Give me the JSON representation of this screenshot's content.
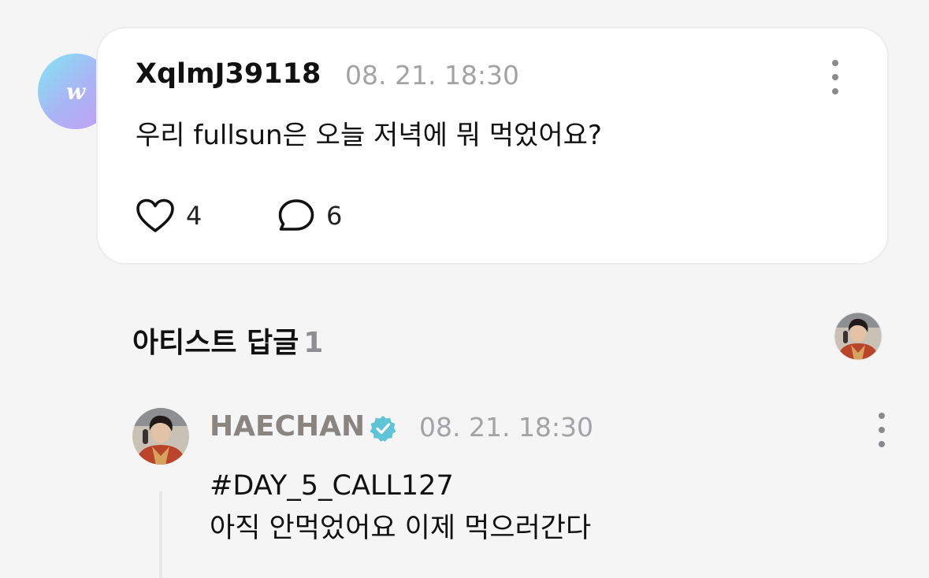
{
  "post": {
    "author": "XqlmJ39118",
    "time": "08. 21. 18:30",
    "avatar_letter": "w",
    "text": "우리 fullsun은 오늘 저녁에 뭐 먹었어요?",
    "likes": "4",
    "comments": "6",
    "icons": {
      "like": "heart-outline-icon",
      "comment": "speech-bubble-icon",
      "more": "more-vertical-icon"
    }
  },
  "artist_replies": {
    "title": "아티스트 답글",
    "count": "1"
  },
  "reply": {
    "author": "HAECHAN",
    "verified_color": "#5fc4d8",
    "time": "08. 21. 18:30",
    "lines": [
      "#DAY_5_CALL127",
      "아직 안먹었어요 이제 먹으러간다"
    ]
  },
  "colors": {
    "background": "#f5f5f6",
    "card": "#ffffff",
    "muted": "#a3a3a6",
    "artist_name": "#8a8580"
  }
}
